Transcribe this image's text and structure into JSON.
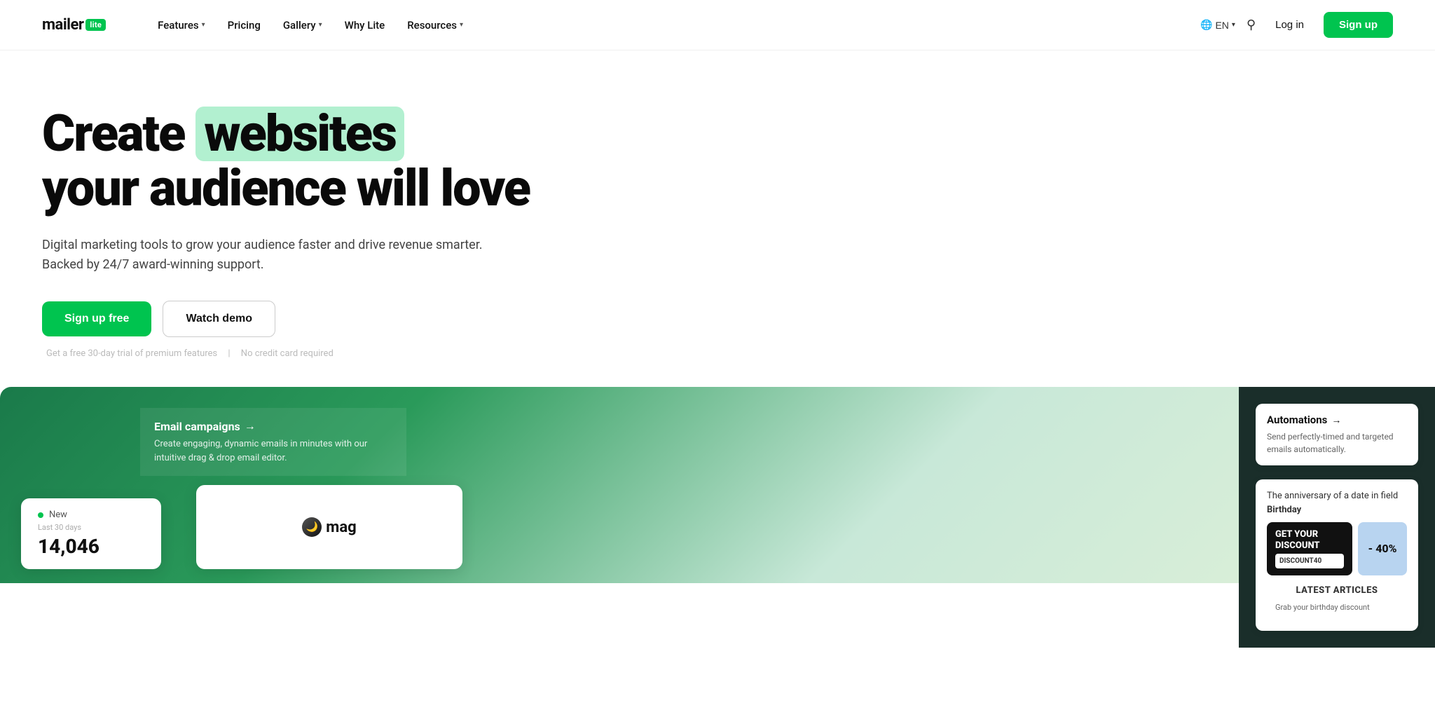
{
  "logo": {
    "text": "mailer",
    "badge": "lite"
  },
  "nav": {
    "items": [
      {
        "label": "Features",
        "hasDropdown": true
      },
      {
        "label": "Pricing",
        "hasDropdown": false
      },
      {
        "label": "Gallery",
        "hasDropdown": true
      },
      {
        "label": "Why Lite",
        "hasDropdown": false
      },
      {
        "label": "Resources",
        "hasDropdown": true
      }
    ],
    "lang": "EN",
    "login": "Log in",
    "signup": "Sign up"
  },
  "hero": {
    "line1_plain": "Create",
    "line1_highlight": "websites",
    "line2": "your audience will love",
    "subtitle": "Digital marketing tools to grow your audience faster and drive revenue smarter. Backed by 24/7 award-winning support.",
    "cta_primary": "Sign up free",
    "cta_secondary": "Watch demo",
    "note_part1": "Get a free 30-day trial of premium features",
    "note_separator": "|",
    "note_part2": "No credit card required"
  },
  "automations_panel": {
    "title": "Automations",
    "arrow": "→",
    "description": "Send perfectly-timed and targeted emails automatically.",
    "birthday_text": "The anniversary of a date in field",
    "birthday_field": "Birthday"
  },
  "email_campaigns": {
    "title": "Email campaigns",
    "arrow": "→",
    "description": "Create engaging, dynamic emails in minutes with our intuitive drag & drop email editor."
  },
  "stats_card": {
    "status_dot": "New",
    "sublabel": "Last 30 days",
    "number": "14,046"
  },
  "mag_logo": "mag",
  "promo": {
    "title": "GET YOUR DISCOUNT",
    "discount": "- 40%",
    "code": "DISCOUNT40"
  },
  "articles": {
    "title": "LATEST ARTICLES",
    "description": "Grab your birthday discount"
  },
  "colors": {
    "green": "#00c44f",
    "highlight_bg": "#b2f0d0",
    "dark_bg": "#1a2e2a"
  }
}
